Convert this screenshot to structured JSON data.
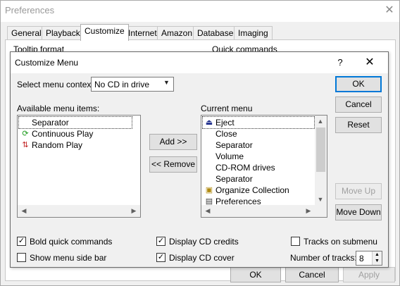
{
  "preferences": {
    "title": "Preferences",
    "close_glyph": "✕",
    "tabs": [
      {
        "label": "General"
      },
      {
        "label": "Playback"
      },
      {
        "label": "Customize"
      },
      {
        "label": "Internet"
      },
      {
        "label": "Amazon"
      },
      {
        "label": "Database"
      },
      {
        "label": "Imaging"
      }
    ],
    "group_tooltip_label": "Tooltip format",
    "group_quick_label": "Quick commands",
    "ok_label": "OK",
    "cancel_label": "Cancel",
    "apply_label": "Apply"
  },
  "dialog": {
    "title": "Customize Menu",
    "help_glyph": "?",
    "close_glyph": "✕",
    "context_label": "Select menu context:",
    "context_value": "No CD in drive",
    "available_label": "Available menu items:",
    "available_items": [
      {
        "label": "Separator",
        "icon": "none"
      },
      {
        "label": "Continuous Play",
        "icon": "loop-icon",
        "color": "#1a9a1a"
      },
      {
        "label": "Random Play",
        "icon": "shuffle-icon",
        "color": "#c02020"
      }
    ],
    "add_label": "Add >>",
    "remove_label": "<< Remove",
    "current_label": "Current menu",
    "current_items": [
      {
        "label": "Eject",
        "icon": "eject-icon"
      },
      {
        "label": "Close",
        "icon": "none"
      },
      {
        "label": "Separator",
        "icon": "none"
      },
      {
        "label": "Volume",
        "icon": "none"
      },
      {
        "label": "CD-ROM drives",
        "icon": "none"
      },
      {
        "label": "Separator",
        "icon": "none"
      },
      {
        "label": "Organize Collection",
        "icon": "organize-icon"
      },
      {
        "label": "Preferences",
        "icon": "preferences-icon"
      }
    ],
    "ok_label": "OK",
    "cancel_label": "Cancel",
    "reset_label": "Reset",
    "move_up_label": "Move Up",
    "move_down_label": "Move Down",
    "checkboxes": {
      "bold_quick": {
        "label": "Bold quick commands",
        "checked": true
      },
      "show_side_bar": {
        "label": "Show menu side bar",
        "checked": false
      },
      "display_credits": {
        "label": "Display CD credits",
        "checked": true
      },
      "display_cover": {
        "label": "Display CD cover",
        "checked": true
      },
      "tracks_submenu": {
        "label": "Tracks on submenu",
        "checked": false
      }
    },
    "tracks_label": "Number of tracks:",
    "tracks_value": "8"
  },
  "colors": {
    "default_button_border": "#0078d7",
    "selection_outline": "#333333"
  }
}
